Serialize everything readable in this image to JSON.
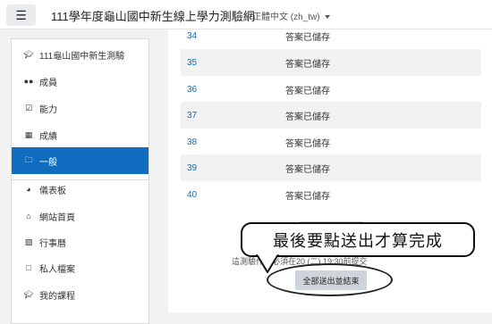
{
  "navbar": {
    "menu_icon": "hamburger-icon",
    "site_title": "111學年度龜山國中新生線上學力測驗網",
    "language": "正體中文 (zh_tw)"
  },
  "sidebar": {
    "items": [
      {
        "label": "111龜山國中新生測驗",
        "icon": "graduation-cap-icon"
      },
      {
        "label": "成員",
        "icon": "users-icon"
      },
      {
        "label": "能力",
        "icon": "check-square-icon"
      },
      {
        "label": "成績",
        "icon": "table-icon"
      },
      {
        "label": "一般",
        "icon": "folder-icon",
        "active": true
      },
      {
        "label": "儀表板",
        "icon": "dashboard-icon"
      },
      {
        "label": "網站首頁",
        "icon": "home-icon"
      },
      {
        "label": "行事曆",
        "icon": "calendar-icon"
      },
      {
        "label": "私人檔案",
        "icon": "file-icon"
      },
      {
        "label": "我的課程",
        "icon": "graduation-cap-icon"
      }
    ]
  },
  "main": {
    "rows": [
      {
        "num": "34",
        "status": "答案已儲存"
      },
      {
        "num": "35",
        "status": "答案已儲存"
      },
      {
        "num": "36",
        "status": "答案已儲存"
      },
      {
        "num": "37",
        "status": "答案已儲存"
      },
      {
        "num": "38",
        "status": "答案已儲存"
      },
      {
        "num": "39",
        "status": "答案已儲存"
      },
      {
        "num": "40",
        "status": "答案已儲存"
      }
    ],
    "note": "這測驗作答必須在20        (二) 19:30前提交",
    "submit_label": "全部送出並結束"
  },
  "callout": {
    "text": "最後要點送出才算完成"
  }
}
